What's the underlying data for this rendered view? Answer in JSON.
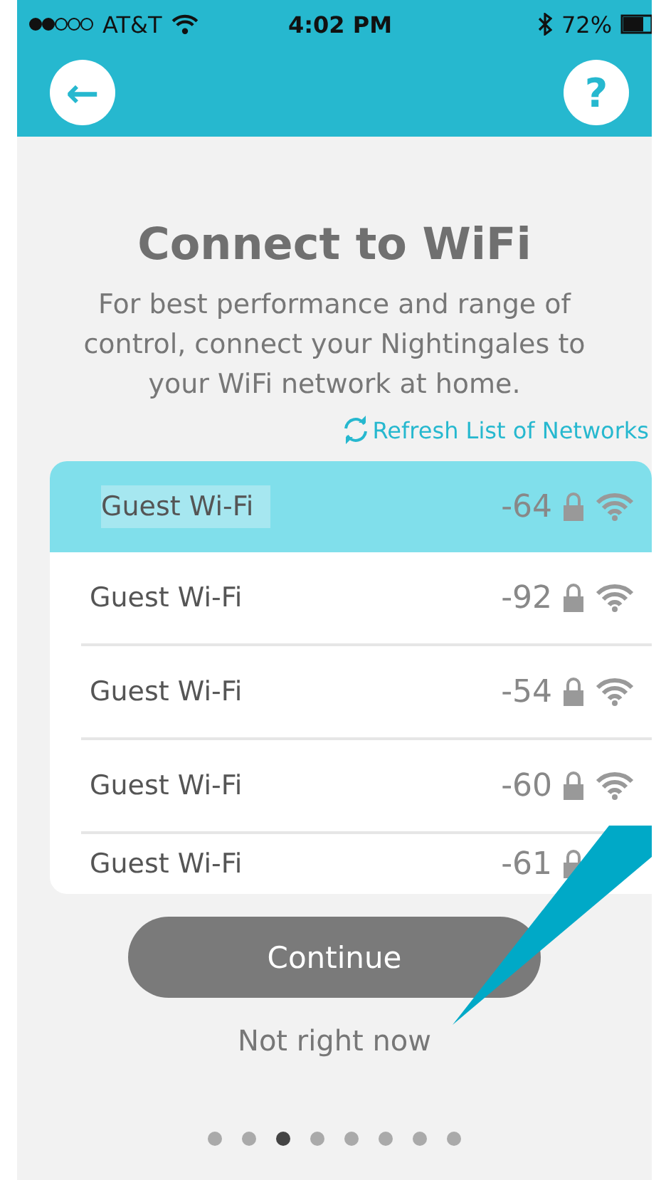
{
  "status_bar": {
    "carrier": "AT&T",
    "time": "4:02 PM",
    "battery": "72%"
  },
  "header": {
    "back_label": "←",
    "help_label": "?"
  },
  "title": "Connect to WiFi",
  "subtitle": "For best performance and range of control, connect your Nightingales to your WiFi network at home.",
  "refresh_link": "Refresh List of Networks",
  "networks": [
    {
      "name": "Guest Wi-Fi",
      "strength": "-64",
      "selected": true
    },
    {
      "name": "Guest Wi-Fi",
      "strength": "-92",
      "selected": false
    },
    {
      "name": "Guest Wi-Fi",
      "strength": "-54",
      "selected": false
    },
    {
      "name": "Guest Wi-Fi",
      "strength": "-60",
      "selected": false
    },
    {
      "name": "Guest Wi-Fi",
      "strength": "-61",
      "selected": false
    }
  ],
  "continue_button": "Continue",
  "skip_link": "Not right now",
  "pages": [
    {
      "selected": false
    },
    {
      "selected": false
    },
    {
      "selected": true
    },
    {
      "selected": false
    },
    {
      "selected": false
    },
    {
      "selected": false
    },
    {
      "selected": false
    },
    {
      "selected": false
    }
  ]
}
